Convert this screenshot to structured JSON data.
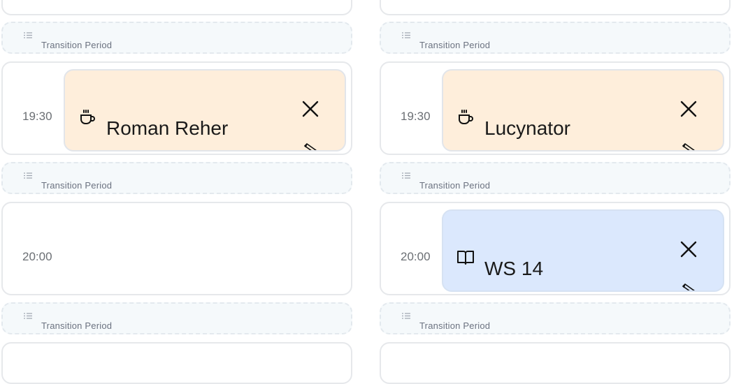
{
  "transition_label": "Transition Period",
  "columns": [
    {
      "slots": [
        {
          "time": "19:30",
          "event": {
            "title": "Roman Reher",
            "icon": "coffee-icon",
            "color": "#feeedb"
          }
        },
        {
          "time": "20:00",
          "event": null
        }
      ]
    },
    {
      "slots": [
        {
          "time": "19:30",
          "event": {
            "title": "Lucynator",
            "icon": "coffee-icon",
            "color": "#feeedb"
          }
        },
        {
          "time": "20:00",
          "event": {
            "title": "WS 14",
            "icon": "book-icon",
            "color": "#dbe8fd"
          }
        }
      ]
    }
  ]
}
